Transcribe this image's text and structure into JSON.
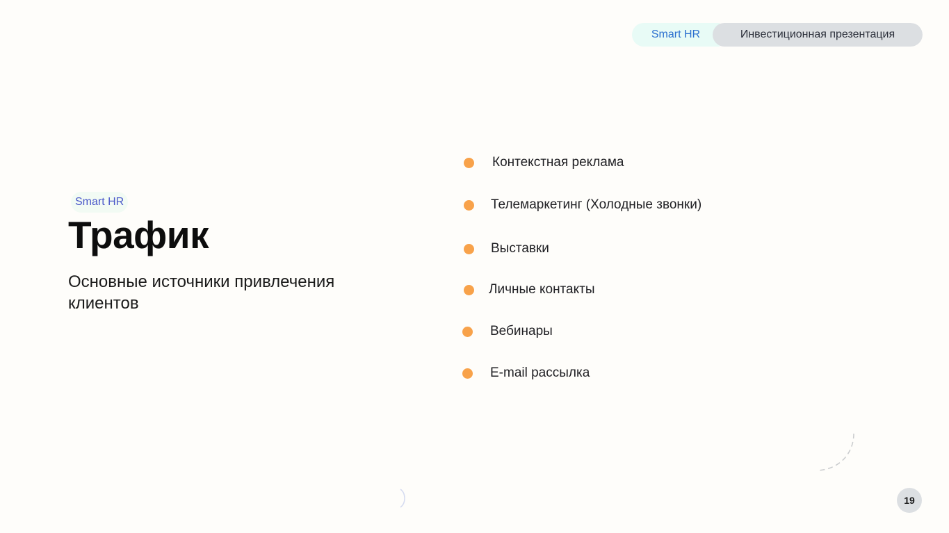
{
  "header": {
    "brand": "Smart HR",
    "presentation_title": "Инвестиционная презентация"
  },
  "slide": {
    "tag": "Smart HR",
    "title": "Трафик",
    "subtitle": "Основные источники привлечения клиентов",
    "bullets": [
      "Контекстная реклама",
      "Телемаркетинг (Холодные звонки)",
      "Выставки",
      "Личные контакты",
      "Вебинары",
      "E-mail рассылка"
    ]
  },
  "page_number": "19",
  "colors": {
    "background": "#fefdfa",
    "bullet": "#f8a24a",
    "brand_text": "#2a6fcf",
    "header_pill": "#dcdfe2",
    "tag_text": "#4a58c9"
  }
}
